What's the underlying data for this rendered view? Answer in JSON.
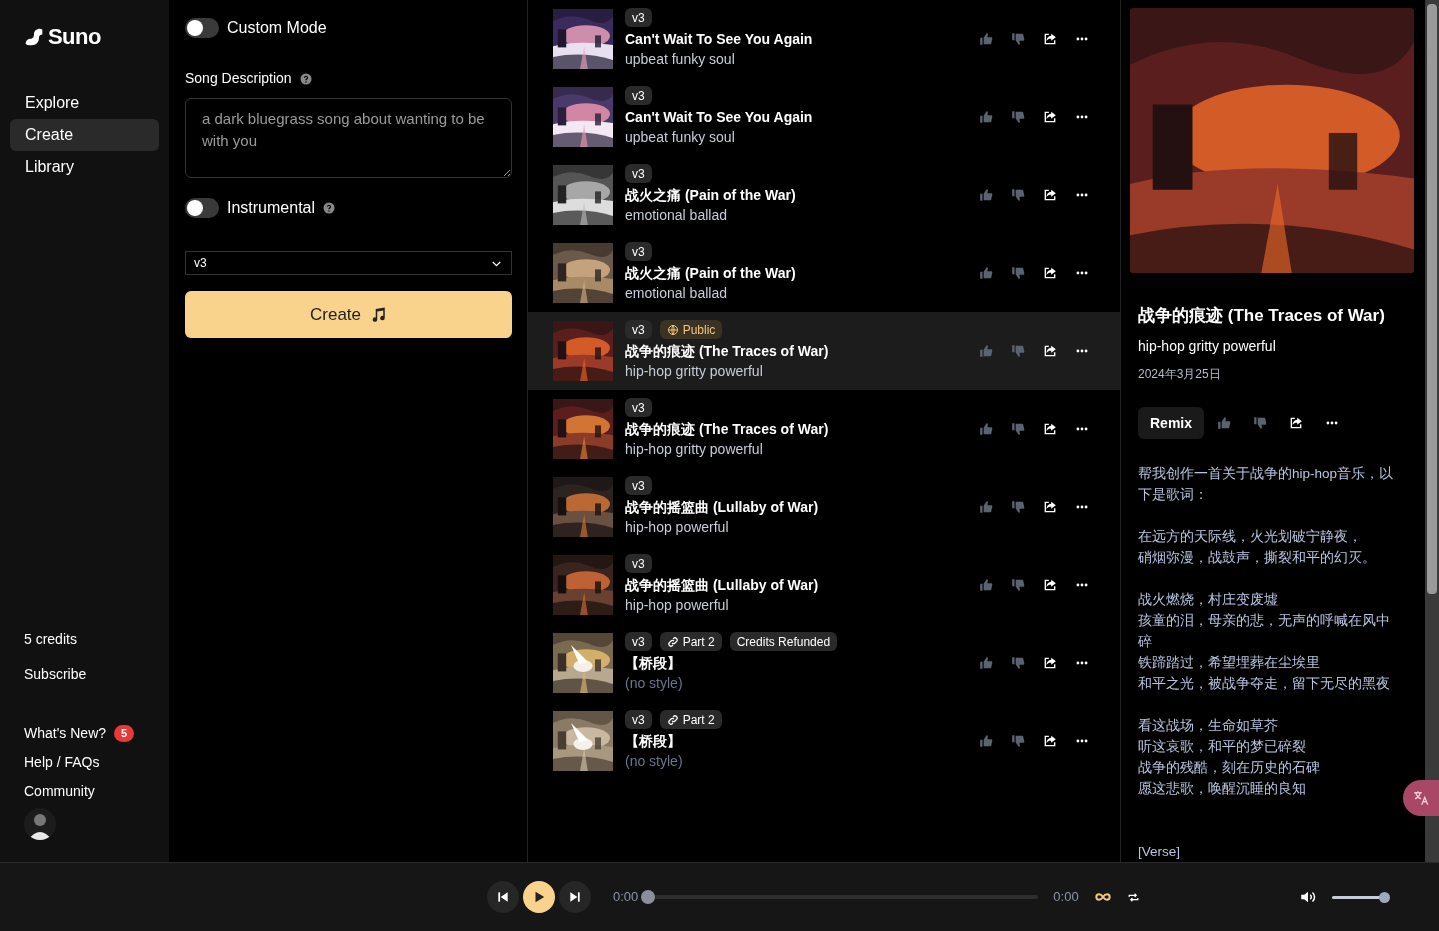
{
  "sidebar": {
    "logo": "Suno",
    "nav": [
      {
        "label": "Explore",
        "selected": false
      },
      {
        "label": "Create",
        "selected": true
      },
      {
        "label": "Library",
        "selected": false
      }
    ],
    "credits": "5 credits",
    "subscribe": "Subscribe",
    "links": [
      {
        "label": "What's New?",
        "badge": "5"
      },
      {
        "label": "Help / FAQs"
      },
      {
        "label": "Community"
      }
    ]
  },
  "create": {
    "custom_mode": {
      "label": "Custom Mode",
      "on": false
    },
    "description_label": "Song Description",
    "description": "a dark bluegrass song about wanting to be with you",
    "instrumental": {
      "label": "Instrumental",
      "on": false
    },
    "model": "v3",
    "button": "Create"
  },
  "songs": [
    {
      "title": "Can't Wait To See You Again",
      "style": "upbeat funky soul",
      "selected": false,
      "tags": [
        {
          "kind": "version",
          "text": "v3"
        }
      ]
    },
    {
      "title": "Can't Wait To See You Again",
      "style": "upbeat funky soul",
      "selected": false,
      "tags": [
        {
          "kind": "version",
          "text": "v3"
        }
      ]
    },
    {
      "title": "战火之痛 (Pain of the War)",
      "style": "emotional ballad",
      "selected": false,
      "tags": [
        {
          "kind": "version",
          "text": "v3"
        }
      ]
    },
    {
      "title": "战火之痛 (Pain of the War)",
      "style": "emotional ballad",
      "selected": false,
      "tags": [
        {
          "kind": "version",
          "text": "v3"
        }
      ]
    },
    {
      "title": "战争的痕迹 (The Traces of War)",
      "style": "hip-hop gritty powerful",
      "selected": true,
      "tags": [
        {
          "kind": "version",
          "text": "v3"
        },
        {
          "kind": "public",
          "text": "Public"
        }
      ]
    },
    {
      "title": "战争的痕迹 (The Traces of War)",
      "style": "hip-hop gritty powerful",
      "selected": false,
      "tags": [
        {
          "kind": "version",
          "text": "v3"
        }
      ]
    },
    {
      "title": "战争的摇篮曲 (Lullaby of War)",
      "style": "hip-hop powerful",
      "selected": false,
      "tags": [
        {
          "kind": "version",
          "text": "v3"
        }
      ]
    },
    {
      "title": "战争的摇篮曲 (Lullaby of War)",
      "style": "hip-hop powerful",
      "selected": false,
      "tags": [
        {
          "kind": "version",
          "text": "v3"
        }
      ]
    },
    {
      "title": "【桥段】",
      "style": "(no style)",
      "selected": false,
      "tags": [
        {
          "kind": "version",
          "text": "v3"
        },
        {
          "kind": "part",
          "text": "Part 2"
        },
        {
          "kind": "plain",
          "text": "Credits Refunded"
        }
      ]
    },
    {
      "title": "【桥段】",
      "style": "(no style)",
      "selected": false,
      "tags": [
        {
          "kind": "version",
          "text": "v3"
        },
        {
          "kind": "part",
          "text": "Part 2"
        }
      ]
    }
  ],
  "detail": {
    "title": "战争的痕迹 (The Traces of War)",
    "style": "hip-hop gritty powerful",
    "date": "2024年3月25日",
    "remix": "Remix",
    "lyrics": [
      [
        "帮我创作一首关于战争的hip-hop音乐，以下是歌词："
      ],
      [
        "在远方的天际线，火光划破宁静夜，",
        "硝烟弥漫，战鼓声，撕裂和平的幻灭。"
      ],
      [
        "战火燃烧，村庄变废墟",
        "孩童的泪，母亲的悲，无声的呼喊在风中碎",
        "铁蹄踏过，希望埋葬在尘埃里",
        "和平之光，被战争夺走，留下无尽的黑夜"
      ],
      [
        "看这战场，生命如草芥",
        "听这哀歌，和平的梦已碎裂",
        "战争的残酷，刻在历史的石碑",
        "愿这悲歌，唤醒沉睡的良知"
      ],
      [
        "[Verse]"
      ]
    ]
  },
  "player": {
    "elapsed": "0:00",
    "progress": {
      "level": 0
    },
    "duration": "0:00",
    "volume": {
      "level": 0.93
    }
  }
}
